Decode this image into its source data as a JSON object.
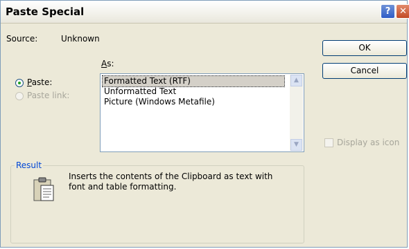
{
  "window": {
    "title": "Paste Special",
    "help_glyph": "?",
    "close_glyph": "✕"
  },
  "source": {
    "label": "Source:",
    "value": "Unknown"
  },
  "as_label": "As:",
  "options": {
    "paste": {
      "label": "Paste:",
      "checked": true
    },
    "paste_link": {
      "label": "Paste link:",
      "enabled": false
    }
  },
  "list": {
    "items": [
      "Formatted Text (RTF)",
      "Unformatted Text",
      "Picture (Windows Metafile)"
    ],
    "selected_index": 0
  },
  "buttons": {
    "ok": "OK",
    "cancel": "Cancel"
  },
  "display_as_icon": {
    "label": "Display as icon",
    "checked": false,
    "enabled": false
  },
  "result": {
    "legend": "Result",
    "text_line1": "Inserts the contents of the Clipboard as text with",
    "text_line2": "font and table formatting.",
    "icon": "clipboard-paste-icon"
  },
  "colors": {
    "dialog_bg": "#ece9d8",
    "selected_item_bg": "#d4d0c8",
    "groupbox_legend": "#0046d5",
    "disabled_text": "#a7a69b"
  }
}
